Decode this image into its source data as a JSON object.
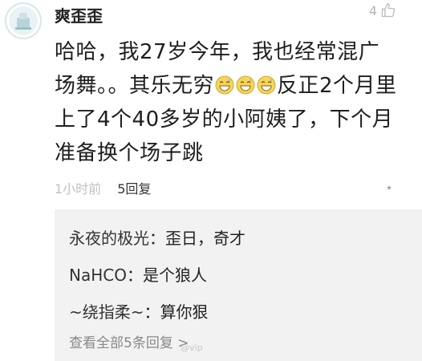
{
  "comment": {
    "username": "爽歪歪",
    "like_count": "4",
    "text_before_emoji": "哈哈，我27岁今年，我也经常混广场舞。。其乐无穷",
    "emoji": [
      "grin-sweat-emoji",
      "grin-sweat-emoji",
      "grin-sweat-emoji"
    ],
    "text_after_emoji": "反正2个月里上了4个40多岁的小阿姨了，下个月准备换个场子跳",
    "time": "1小时前",
    "reply_count_label": "5回复",
    "more_label": "⋆"
  },
  "replies": [
    {
      "author": "永夜的极光",
      "sep": "：",
      "text": "歪日，奇才"
    },
    {
      "author": "NaHCO",
      "sep": "：",
      "text": "是个狼人"
    },
    {
      "author": "~绕指柔~",
      "sep": "：",
      "text": "算你狠"
    }
  ],
  "view_all_label": "查看全部5条回复 >",
  "watermark": "@vip"
}
